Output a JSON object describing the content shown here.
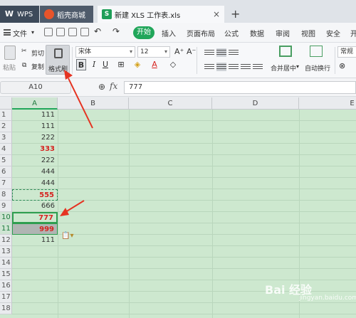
{
  "tabs": [
    {
      "label": "WPS",
      "icon": "wps-logo-icon"
    },
    {
      "label": "稻壳商城",
      "icon": "docer-icon"
    },
    {
      "label": "新建 XLS 工作表.xls",
      "icon": "spreadsheet-icon",
      "close": "×"
    }
  ],
  "new_tab_label": "+",
  "menu": {
    "file_label": "文件",
    "items": [
      "开始",
      "插入",
      "页面布局",
      "公式",
      "数据",
      "审阅",
      "视图",
      "安全",
      "开"
    ]
  },
  "ribbon": {
    "paste_label": "粘贴",
    "cut_label": "剪切",
    "copy_label": "复制",
    "format_painter_label": "格式刷",
    "font_name": "宋体",
    "font_size": "12",
    "font_grow": "A⁺",
    "font_shrink": "A⁻",
    "bold": "B",
    "italic": "I",
    "underline": "U",
    "merge_label": "合并居中",
    "wrap_label": "自动换行",
    "number_format": "常规"
  },
  "formula_bar": {
    "name_box": "A10",
    "fx_label": "fx",
    "content": "777"
  },
  "columns": [
    "A",
    "B",
    "C",
    "D",
    "E"
  ],
  "rows": [
    "1",
    "2",
    "3",
    "4",
    "5",
    "6",
    "7",
    "8",
    "9",
    "10",
    "11",
    "12",
    "13",
    "14",
    "15",
    "16",
    "17",
    "18"
  ],
  "column_a_values": [
    "111",
    "111",
    "222",
    "333",
    "222",
    "444",
    "444",
    "555",
    "666",
    "777",
    "999",
    "111"
  ],
  "watermark": {
    "brand": "Bai 经验",
    "sub": "jingyan.baidu.com"
  },
  "colors": {
    "accent": "#21a65a",
    "red_text": "#d6231f",
    "grid_bg": "#cde8cf",
    "arrow": "#e53321"
  }
}
